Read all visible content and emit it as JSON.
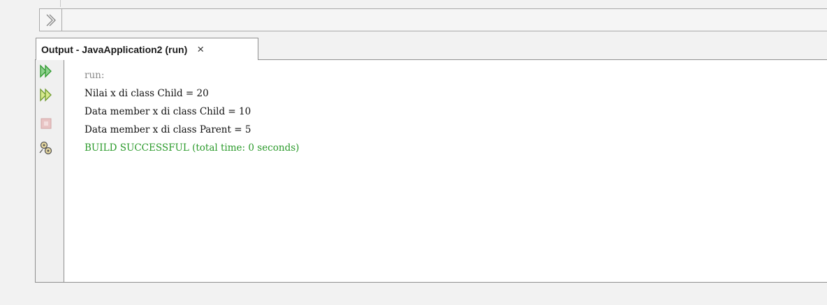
{
  "toolbar": {
    "expand_icon": "double-chevron-right-icon"
  },
  "output_window": {
    "tab_title": "Output - JavaApplication2 (run)",
    "close_glyph": "×"
  },
  "gutter": {
    "buttons": [
      {
        "icon": "rerun-icon",
        "color": "#2f9a2f"
      },
      {
        "icon": "rerun-with-params-icon",
        "color": "#2f9a2f"
      },
      {
        "icon": "stop-icon",
        "color": "#d8a8a8"
      },
      {
        "icon": "settings-icon",
        "color": "#555555"
      }
    ]
  },
  "console": {
    "lines": [
      "run:",
      "Nilai x di class Child = 20",
      "Data member x di class Child = 10",
      "Data member x di class Parent = 5",
      "BUILD SUCCESSFUL (total time: 0 seconds)"
    ]
  },
  "colors": {
    "run_text": "#8a8a8a",
    "output_text": "#101010",
    "success_text": "#2a9a2a"
  }
}
